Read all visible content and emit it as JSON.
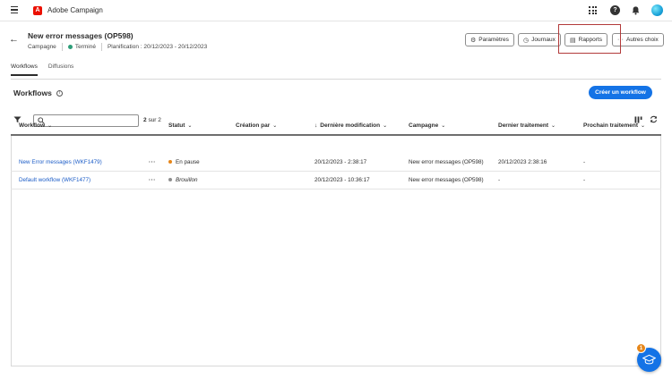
{
  "app": {
    "name": "Adobe Campaign"
  },
  "header": {
    "title": "New error messages (OP598)",
    "type": "Campagne",
    "status": "Terminé",
    "schedule": "Planification : 20/12/2023 - 20/12/2023",
    "buttons": {
      "parametres": "Paramètres",
      "journaux": "Journaux",
      "rapports": "Rapports",
      "autres": "Autres choix"
    }
  },
  "tabs": [
    {
      "label": "Workflows",
      "active": true
    },
    {
      "label": "Diffusions",
      "active": false
    }
  ],
  "section": {
    "title": "Workflows",
    "create_label": "Créer un workflow"
  },
  "toolbar": {
    "search_placeholder": "",
    "count_value": "2",
    "count_suffix": "sur 2"
  },
  "table": {
    "columns": [
      "Workflow",
      "Statut",
      "Création par",
      "Dernière modification",
      "Campagne",
      "Dernier traitement",
      "Prochain traitement"
    ],
    "rows": [
      {
        "workflow": "New Error messages (WKF1479)",
        "more": "···",
        "status": "En pause",
        "status_color": "#e68619",
        "created_by": "",
        "modified": "20/12/2023 - 2:38:17",
        "campaign": "New error messages (OP598)",
        "last_run": "20/12/2023 2:38:16",
        "next_run": "-"
      },
      {
        "workflow": "Default workflow (WKF1477)",
        "more": "···",
        "status": "Brouillon",
        "status_color": "#8e8e8e",
        "created_by": "",
        "modified": "20/12/2023 - 10:36:17",
        "campaign": "New error messages (OP598)",
        "last_run": "-",
        "next_run": "-"
      }
    ]
  },
  "help": {
    "badge": "1"
  },
  "colors": {
    "accent": "#1473e6",
    "status_done": "#2d9d78",
    "highlight": "#b23a3a"
  }
}
